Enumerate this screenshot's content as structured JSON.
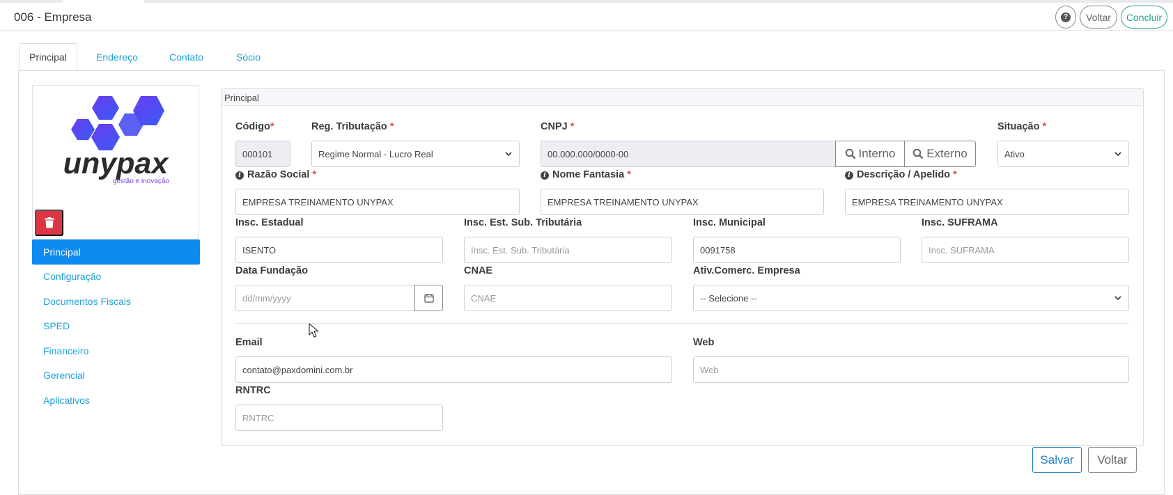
{
  "header": {
    "title": "006 - Empresa",
    "help_label": "?",
    "voltar_label": "Voltar",
    "concluir_label": "Concluir"
  },
  "tabs": [
    {
      "label": "Principal",
      "active": true
    },
    {
      "label": "Endereço",
      "active": false
    },
    {
      "label": "Contato",
      "active": false
    },
    {
      "label": "Sócio",
      "active": false
    }
  ],
  "logo": {
    "text": "unypax",
    "tagline": "gestão e inovação"
  },
  "sidebar": {
    "items": [
      {
        "label": "Principal",
        "active": true
      },
      {
        "label": "Configuração"
      },
      {
        "label": "Documentos Fiscais"
      },
      {
        "label": "SPED"
      },
      {
        "label": "Financeiro"
      },
      {
        "label": "Gerencial"
      },
      {
        "label": "Aplicativos"
      }
    ]
  },
  "section": {
    "legend": "Principal"
  },
  "form": {
    "codigo": {
      "label": "Código",
      "required": "*",
      "value": "000101"
    },
    "reg_tributacao": {
      "label": "Reg. Tributação",
      "required": "*",
      "value": "Regime Normal - Lucro Real"
    },
    "cnpj": {
      "label": "CNPJ",
      "required": "*",
      "value": "00.000.000/0000-00",
      "interno_label": "Interno",
      "externo_label": "Externo"
    },
    "situacao": {
      "label": "Situação",
      "required": "*",
      "value": "Ativo"
    },
    "razao_social": {
      "label": "Razão Social",
      "required": "*",
      "value": "EMPRESA TREINAMENTO UNYPAX"
    },
    "nome_fantasia": {
      "label": "Nome Fantasia",
      "required": "*",
      "value": "EMPRESA TREINAMENTO UNYPAX"
    },
    "descricao": {
      "label": "Descrição / Apelido",
      "required": "*",
      "value": "EMPRESA TREINAMENTO UNYPAX"
    },
    "insc_estadual": {
      "label": "Insc. Estadual",
      "value": "ISENTO"
    },
    "insc_est_sub": {
      "label": "Insc. Est. Sub. Tributária",
      "placeholder": "Insc. Est. Sub. Tributária"
    },
    "insc_municipal": {
      "label": "Insc. Municipal",
      "value": "0091758"
    },
    "insc_suframa": {
      "label": "Insc. SUFRAMA",
      "placeholder": "Insc. SUFRAMA"
    },
    "data_fundacao": {
      "label": "Data Fundação",
      "placeholder": "dd/mm/yyyy"
    },
    "cnae": {
      "label": "CNAE",
      "placeholder": "CNAE"
    },
    "ativ_comerc": {
      "label": "Ativ.Comerc. Empresa",
      "value": "-- Selecione --"
    },
    "email": {
      "label": "Email",
      "value": "contato@paxdomini.com.br"
    },
    "web": {
      "label": "Web",
      "placeholder": "Web"
    },
    "rntrc": {
      "label": "RNTRC",
      "placeholder": "RNTRC"
    }
  },
  "footer": {
    "salvar_label": "Salvar",
    "voltar_label": "Voltar"
  },
  "colors": {
    "accent": "#0d8bf0",
    "link": "#1fa2d9",
    "danger": "#dc3545",
    "required": "#d9534f",
    "teal": "#2a9d8f"
  }
}
